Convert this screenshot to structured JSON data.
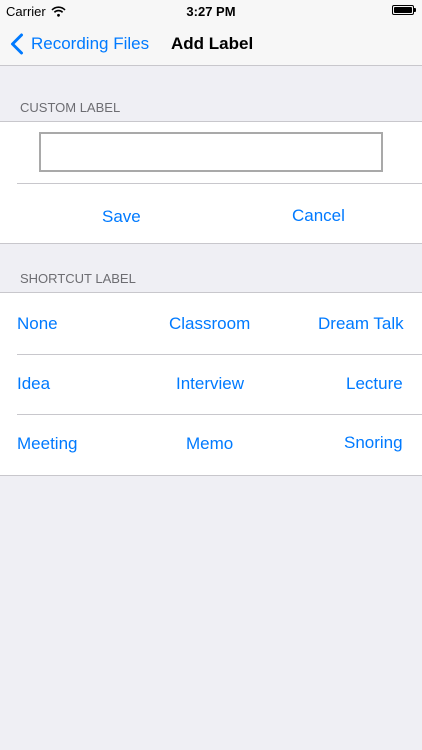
{
  "status_bar": {
    "carrier": "Carrier",
    "time": "3:27 PM",
    "battery_level": 1.0
  },
  "nav": {
    "back_label": "Recording Files",
    "title": "Add Label"
  },
  "custom_label": {
    "header": "CUSTOM LABEL",
    "input_value": "",
    "save_label": "Save",
    "cancel_label": "Cancel"
  },
  "shortcut_label": {
    "header": "SHORTCUT LABEL",
    "rows": [
      [
        "None",
        "Classroom",
        "Dream Talk"
      ],
      [
        "Idea",
        "Interview",
        "Lecture"
      ],
      [
        "Meeting",
        "Memo",
        "Snoring"
      ]
    ]
  },
  "colors": {
    "accent": "#007aff",
    "background": "#efeff4",
    "separator": "#c8c7cc"
  },
  "icons": {
    "wifi": "wifi-icon",
    "battery": "battery-icon",
    "back": "chevron-left-icon"
  }
}
